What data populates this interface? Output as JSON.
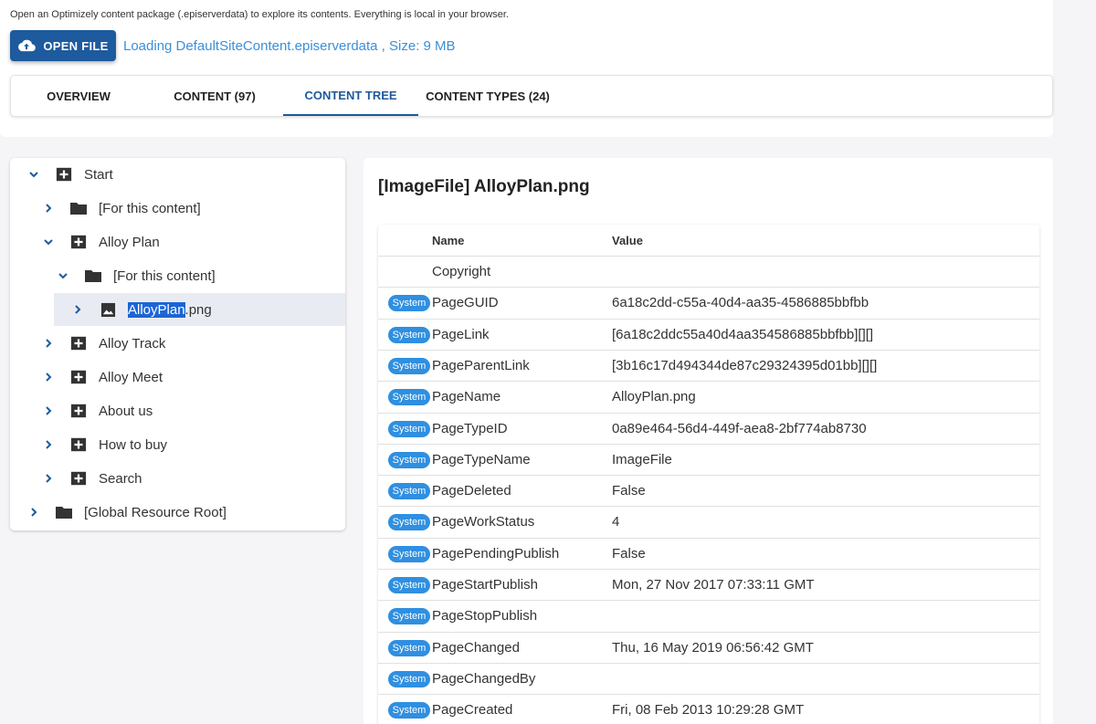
{
  "header": {
    "intro": "Open an Optimizely content package (.episerverdata) to explore its contents. Everything is local in your browser.",
    "open_button_label": "OPEN FILE",
    "loading_text": "Loading DefaultSiteContent.episerverdata , Size: 9 MB"
  },
  "tabs": [
    {
      "label": "OVERVIEW"
    },
    {
      "label": "CONTENT (97)"
    },
    {
      "label": "CONTENT TREE",
      "active": true
    },
    {
      "label": "CONTENT TYPES (24)"
    }
  ],
  "tree": {
    "nodes": [
      {
        "label": "Start",
        "icon": "page-icon",
        "expanded": true
      },
      {
        "label": "[For this content]",
        "icon": "folder-icon"
      },
      {
        "label": "Alloy Plan",
        "icon": "page-icon",
        "expanded": true
      },
      {
        "label": "[For this content]",
        "icon": "folder-icon",
        "expanded": true
      },
      {
        "label_selected": "AlloyPlan",
        "label_rest": ".png",
        "icon": "image-icon",
        "selected": true
      },
      {
        "label": "Alloy Track",
        "icon": "page-icon"
      },
      {
        "label": "Alloy Meet",
        "icon": "page-icon"
      },
      {
        "label": "About us",
        "icon": "page-icon"
      },
      {
        "label": "How to buy",
        "icon": "page-icon"
      },
      {
        "label": "Search",
        "icon": "page-icon"
      },
      {
        "label": "[Global Resource Root]",
        "icon": "folder-icon"
      }
    ]
  },
  "detail": {
    "title": "[ImageFile] AlloyPlan.png",
    "columns": {
      "name": "Name",
      "value": "Value"
    },
    "badge_label": "System",
    "rows": [
      {
        "name": "Copyright",
        "value": "",
        "system": false
      },
      {
        "name": "PageGUID",
        "value": "6a18c2dd-c55a-40d4-aa35-4586885bbfbb",
        "system": true
      },
      {
        "name": "PageLink",
        "value": "[6a18c2ddc55a40d4aa354586885bbfbb][][]",
        "system": true
      },
      {
        "name": "PageParentLink",
        "value": "[3b16c17d494344de87c29324395d01bb][][]",
        "system": true
      },
      {
        "name": "PageName",
        "value": "AlloyPlan.png",
        "system": true
      },
      {
        "name": "PageTypeID",
        "value": "0a89e464-56d4-449f-aea8-2bf774ab8730",
        "system": true
      },
      {
        "name": "PageTypeName",
        "value": "ImageFile",
        "system": true
      },
      {
        "name": "PageDeleted",
        "value": "False",
        "system": true
      },
      {
        "name": "PageWorkStatus",
        "value": "4",
        "system": true
      },
      {
        "name": "PagePendingPublish",
        "value": "False",
        "system": true
      },
      {
        "name": "PageStartPublish",
        "value": "Mon, 27 Nov 2017 07:33:11 GMT",
        "system": true
      },
      {
        "name": "PageStopPublish",
        "value": "",
        "system": true
      },
      {
        "name": "PageChanged",
        "value": "Thu, 16 May 2019 06:56:42 GMT",
        "system": true
      },
      {
        "name": "PageChangedBy",
        "value": "",
        "system": true
      },
      {
        "name": "PageCreated",
        "value": "Fri, 08 Feb 2013 10:29:28 GMT",
        "system": true
      }
    ]
  },
  "colors": {
    "primary": "#1d5a9e",
    "link": "#3b8fd9",
    "badge": "#2f8fe0",
    "selection": "#1b65d6"
  }
}
